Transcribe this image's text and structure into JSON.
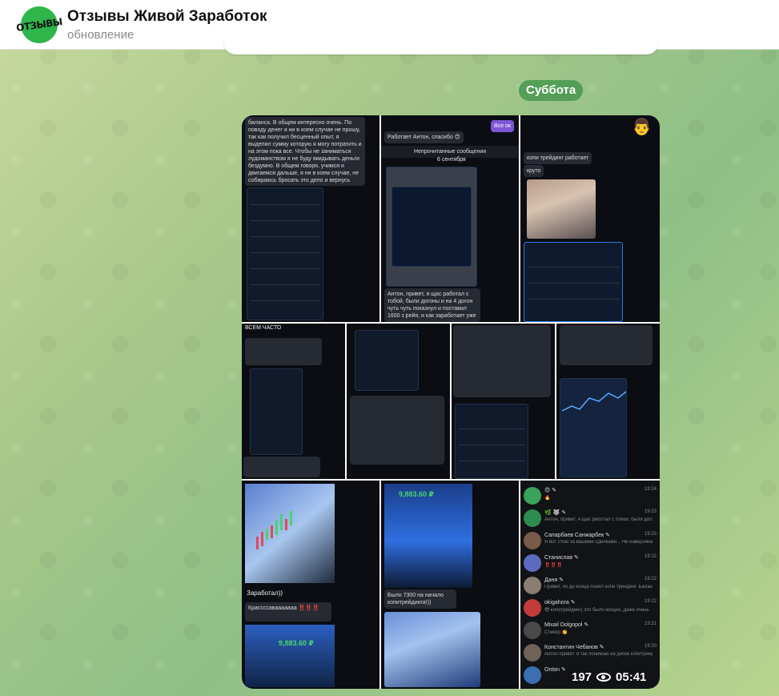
{
  "header": {
    "channel_title": "Отзывы Живой Заработок",
    "status": "обновление",
    "avatar_text": "ОТЗЫВЫ"
  },
  "date_separator": "Суббота",
  "album": {
    "views": "197",
    "time": "05:41",
    "tiles": {
      "t1_text": "баланса. В общем интересно очень. По поводу денег я ни в коем случае не прошу, так как получил бесценный опыт, я выделил сумму которую я могу потратить и на этом пока все. Чтобы не заниматься лудоманством я не буду вкидывать деньги бездумно. В общем говоря, учимся и двигаемся дальше, я ни в коем случае, не собираюсь бросать это дело и вернусь",
      "t2_header": "Все ок",
      "t2_msg": "Работает Антон, спасибо 😊",
      "t2_unread": "Непрочитанные сообщения",
      "t2_date": "6 сентября",
      "t2_caption": "Антон, привет, я щас работал с тобой, были догоны и на 4 догон чуть чуть показнул и поставил 1600 з рейя, и как заработает уже",
      "t3_msg1": "копи трейдинг работает",
      "t3_msg2": "круто",
      "t4_top": "ВСЕМ ЧАСТО",
      "t8_caption": "Заработал))",
      "t9_caption": "Было 7300 на начало копитрейдинга!))",
      "t11_caption": "Крассссавааааааа ‼️‼️‼️",
      "t11_amount": "9,883.60 ₽",
      "t9_amount": "9,883.60 ₽"
    },
    "chat_items": [
      {
        "name": "😍 ✎",
        "preview": "🔥",
        "time": "19:24"
      },
      {
        "name": "🌿 🐺 ✎",
        "preview": "Антон, привет, я щас работал с тобой, были догоны и на 4 догон",
        "time": "19:23"
      },
      {
        "name": "Сапарбаев Санжарбек ✎",
        "preview": "Я вот стою за вашими сделками... Не наверняка... Каковы вашему этому учиться?",
        "time": "19:23"
      },
      {
        "name": "Станислав ✎",
        "preview": "‼️‼️‼️",
        "time": "19:22"
      },
      {
        "name": "Даня ✎",
        "preview": "Привет, по до конца понял копи трейдинг. Баланс на 800$ с кем получается меняли",
        "time": "19:22"
      },
      {
        "name": "okigahora ✎",
        "preview": "😎 копитрейдинг) это было мощно, даже очень",
        "time": "19:22"
      },
      {
        "name": "Mixail Dolgopol ✎",
        "preview": "Стикер 👏",
        "time": "19:21"
      },
      {
        "name": "Константин Чебанов ✎",
        "preview": "Антон привет. я так понимаю на диске копитрейдинг уже не приходят?",
        "time": "19:20"
      },
      {
        "name": "Onton ✎",
        "preview": "",
        "time": ""
      }
    ]
  },
  "colors": {
    "accent_green": "#49d36e",
    "loss_red": "#e3485b",
    "date_pill": "#46964f",
    "avatar_bg": "#2fb64a"
  }
}
